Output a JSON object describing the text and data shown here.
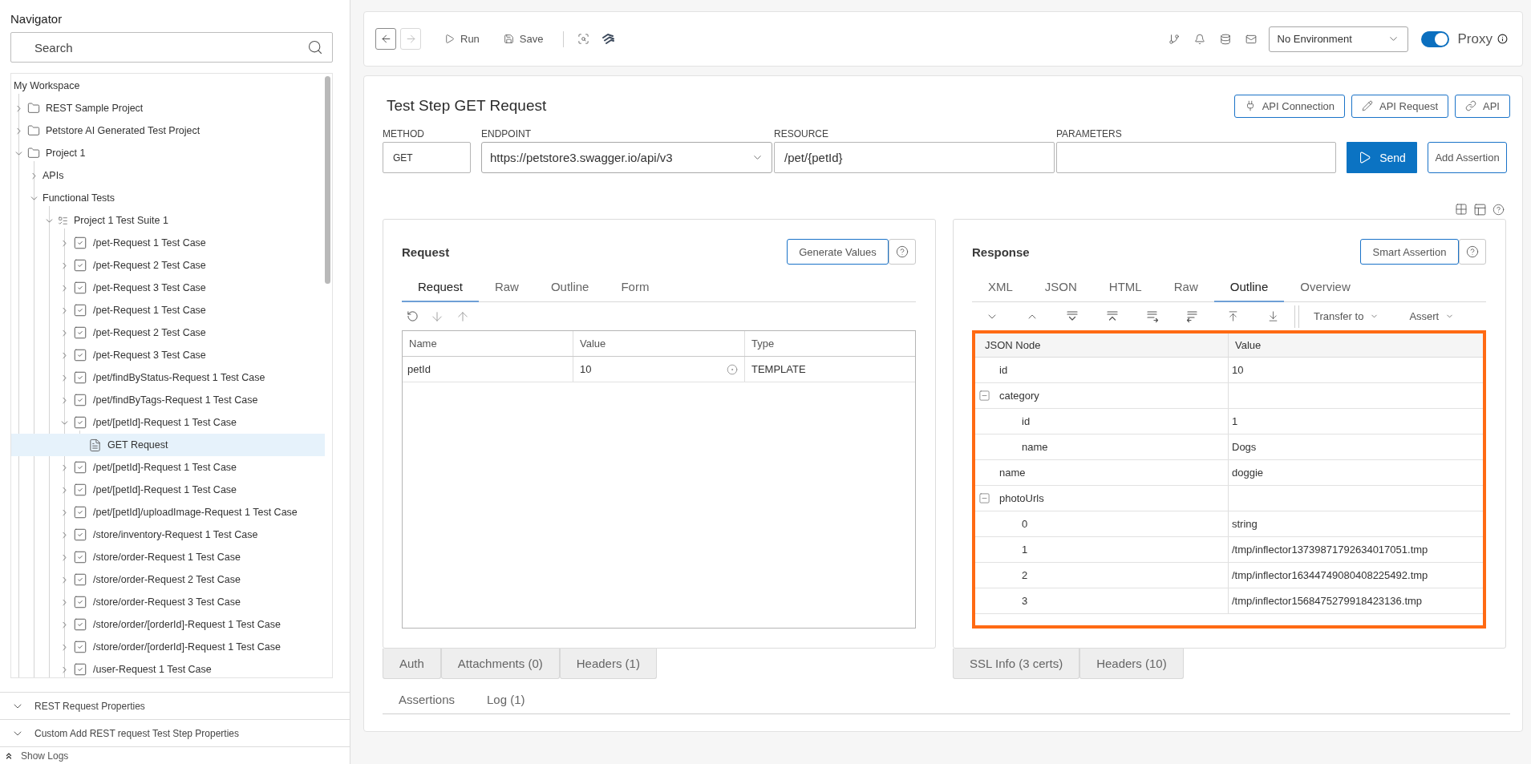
{
  "navigator": {
    "title": "Navigator",
    "search": {
      "placeholder": "Search"
    },
    "tree": [
      {
        "label": "My Workspace",
        "kind": "workspace",
        "selected": false,
        "children": [
          {
            "label": "REST Sample Project",
            "kind": "folder",
            "expanded": false,
            "selected": false
          },
          {
            "label": "Petstore AI Generated Test Project",
            "kind": "folder",
            "expanded": false,
            "selected": false
          },
          {
            "label": "Project 1",
            "kind": "folder",
            "expanded": true,
            "selected": false,
            "children": [
              {
                "label": "APIs",
                "kind": "group",
                "expanded": false,
                "selected": false
              },
              {
                "label": "Functional Tests",
                "kind": "group",
                "expanded": true,
                "selected": false,
                "children": [
                  {
                    "label": "Project 1 Test Suite 1",
                    "kind": "suite",
                    "expanded": true,
                    "selected": false,
                    "children": [
                      {
                        "label": "/pet-Request 1 Test Case",
                        "kind": "testcase",
                        "expanded": false,
                        "selected": false
                      },
                      {
                        "label": "/pet-Request 2 Test Case",
                        "kind": "testcase",
                        "expanded": false,
                        "selected": false
                      },
                      {
                        "label": "/pet-Request 3 Test Case",
                        "kind": "testcase",
                        "expanded": false,
                        "selected": false
                      },
                      {
                        "label": "/pet-Request 1 Test Case",
                        "kind": "testcase",
                        "expanded": false,
                        "selected": false
                      },
                      {
                        "label": "/pet-Request 2 Test Case",
                        "kind": "testcase",
                        "expanded": false,
                        "selected": false
                      },
                      {
                        "label": "/pet-Request 3 Test Case",
                        "kind": "testcase",
                        "expanded": false,
                        "selected": false
                      },
                      {
                        "label": "/pet/findByStatus-Request 1 Test Case",
                        "kind": "testcase",
                        "expanded": false,
                        "selected": false
                      },
                      {
                        "label": "/pet/findByTags-Request 1 Test Case",
                        "kind": "testcase",
                        "expanded": false,
                        "selected": false
                      },
                      {
                        "label": "/pet/[petId]-Request 1 Test Case",
                        "kind": "testcase",
                        "expanded": true,
                        "selected": false,
                        "children": [
                          {
                            "label": "GET Request",
                            "kind": "request",
                            "selected": true
                          }
                        ]
                      },
                      {
                        "label": "/pet/[petId]-Request 1 Test Case",
                        "kind": "testcase",
                        "expanded": false,
                        "selected": false
                      },
                      {
                        "label": "/pet/[petId]-Request 1 Test Case",
                        "kind": "testcase",
                        "expanded": false,
                        "selected": false
                      },
                      {
                        "label": "/pet/[petId]/uploadImage-Request 1 Test Case",
                        "kind": "testcase",
                        "expanded": false,
                        "selected": false
                      },
                      {
                        "label": "/store/inventory-Request 1 Test Case",
                        "kind": "testcase",
                        "expanded": false,
                        "selected": false
                      },
                      {
                        "label": "/store/order-Request 1 Test Case",
                        "kind": "testcase",
                        "expanded": false,
                        "selected": false
                      },
                      {
                        "label": "/store/order-Request 2 Test Case",
                        "kind": "testcase",
                        "expanded": false,
                        "selected": false
                      },
                      {
                        "label": "/store/order-Request 3 Test Case",
                        "kind": "testcase",
                        "expanded": false,
                        "selected": false
                      },
                      {
                        "label": "/store/order/[orderId]-Request 1 Test Case",
                        "kind": "testcase",
                        "expanded": false,
                        "selected": false
                      },
                      {
                        "label": "/store/order/[orderId]-Request 1 Test Case",
                        "kind": "testcase",
                        "expanded": false,
                        "selected": false
                      },
                      {
                        "label": "/user-Request 1 Test Case",
                        "kind": "testcase",
                        "expanded": false,
                        "selected": false
                      }
                    ]
                  }
                ]
              }
            ]
          }
        ]
      }
    ],
    "sections": [
      "REST Request Properties",
      "Custom Add REST request Test Step Properties"
    ],
    "show_logs": "Show Logs"
  },
  "toolbar": {
    "nav": [
      {
        "kind": "back",
        "disabled": false
      },
      {
        "kind": "forward",
        "disabled": true
      }
    ],
    "actions": [
      {
        "kind": "run",
        "label": "Run"
      },
      {
        "kind": "save",
        "label": "Save"
      }
    ],
    "environment": "No Environment",
    "proxy": {
      "label": "Proxy",
      "on": true
    }
  },
  "test_step": {
    "title": "Test Step GET Request",
    "links": [
      {
        "kind": "connection",
        "label": "API Connection"
      },
      {
        "kind": "edit",
        "label": "API Request"
      },
      {
        "kind": "link",
        "label": "API"
      }
    ],
    "method": {
      "label": "METHOD",
      "value": "GET"
    },
    "endpoint": {
      "label": "ENDPOINT",
      "value": "https://petstore3.swagger.io/api/v3"
    },
    "resource": {
      "label": "RESOURCE",
      "value": "/pet/{petId}"
    },
    "parameters": {
      "label": "PARAMETERS"
    },
    "send": "Send",
    "add_assertion": "Add Assertion"
  },
  "request": {
    "title": "Request",
    "action": "Generate Values",
    "tabs": [
      {
        "label": "Request",
        "selected": true
      },
      {
        "label": "Raw",
        "selected": false
      },
      {
        "label": "Outline",
        "selected": false
      },
      {
        "label": "Form",
        "selected": false
      }
    ],
    "table": {
      "columns": [
        "Name",
        "Value",
        "Type"
      ],
      "rows": [
        [
          "petId",
          "10",
          "TEMPLATE"
        ]
      ]
    },
    "bottom_tabs": [
      {
        "label": "Auth",
        "selected": false
      },
      {
        "label": "Attachments (0)",
        "selected": false
      },
      {
        "label": "Headers (1)",
        "selected": false
      }
    ]
  },
  "response": {
    "title": "Response",
    "action": "Smart Assertion",
    "tabs": [
      {
        "label": "XML",
        "selected": false
      },
      {
        "label": "JSON",
        "selected": false
      },
      {
        "label": "HTML",
        "selected": false
      },
      {
        "label": "Raw",
        "selected": false
      },
      {
        "label": "Outline",
        "selected": true
      },
      {
        "label": "Overview",
        "selected": false
      }
    ],
    "menus": [
      "Transfer to",
      "Assert"
    ],
    "table": {
      "columns": [
        "JSON Node",
        "Value"
      ],
      "rows": [
        {
          "key": "id",
          "value": "10"
        },
        {
          "key": "category",
          "expanded": true,
          "children": [
            {
              "key": "id",
              "value": "1"
            },
            {
              "key": "name",
              "value": "Dogs"
            }
          ]
        },
        {
          "key": "name",
          "value": "doggie"
        },
        {
          "key": "photoUrls",
          "expanded": true,
          "children": [
            {
              "key": "0",
              "value": "string"
            },
            {
              "key": "1",
              "value": "/tmp/inflector13739871792634017051.tmp"
            },
            {
              "key": "2",
              "value": "/tmp/inflector16344749080408225492.tmp"
            },
            {
              "key": "3",
              "value": "/tmp/inflector1568475279918423136.tmp"
            }
          ]
        }
      ]
    },
    "bottom_tabs": [
      {
        "label": "SSL Info (3 certs)",
        "selected": false
      },
      {
        "label": "Headers (10)",
        "selected": false
      }
    ]
  },
  "footer_tabs": [
    {
      "label": "Assertions",
      "selected": false
    },
    {
      "label": "Log (1)",
      "selected": false
    }
  ]
}
